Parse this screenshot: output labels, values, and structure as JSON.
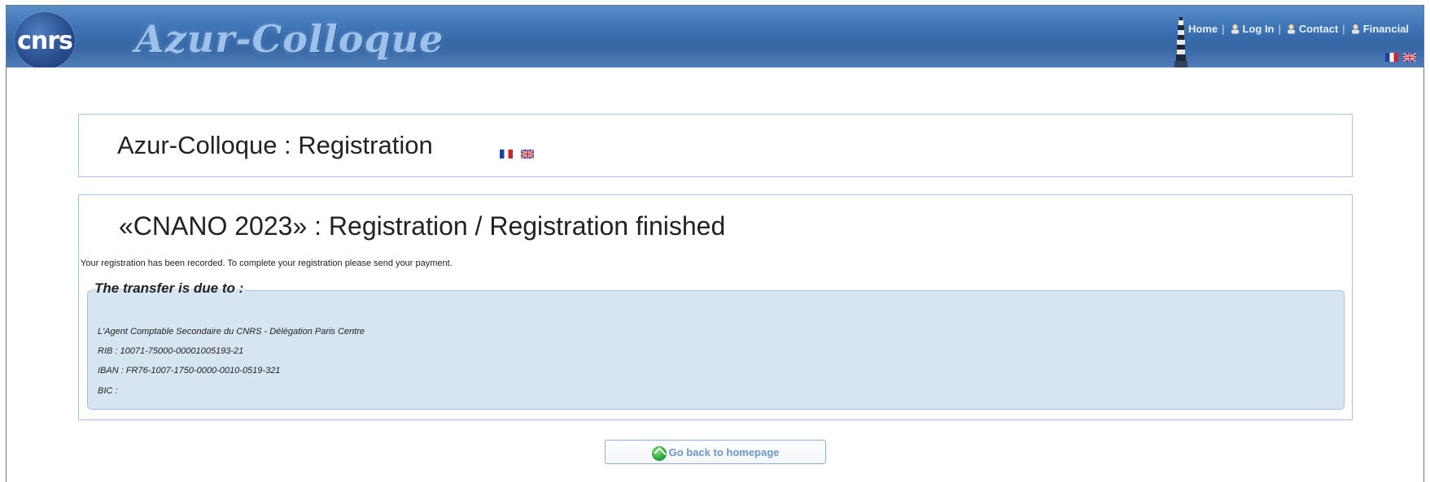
{
  "banner": {
    "logo_text": "cnrs",
    "brand": "Azur-Colloque"
  },
  "topnav": {
    "items": [
      {
        "label": "Home"
      },
      {
        "label": "Log In"
      },
      {
        "label": "Contact"
      },
      {
        "label": "Financial"
      }
    ],
    "separator": "|"
  },
  "header_panel": {
    "title": "Azur-Colloque : Registration"
  },
  "main": {
    "title": "«CNANO 2023» : Registration / Registration finished",
    "notice": "Your registration has been recorded. To complete your registration please send your payment.",
    "transfer": {
      "legend": "The transfer is due to :",
      "lines": [
        "L'Agent Comptable Secondaire du CNRS - Délégation Paris Centre",
        "RIB : 10071-75000-00001005193-21",
        "IBAN : FR76-1007-1750-0000-0010-0519-321",
        "BIC :"
      ]
    }
  },
  "footer": {
    "home_button": "Go back to homepage"
  },
  "colors": {
    "banner": "#3f74b5",
    "panel_border": "#a9c3de",
    "transfer_bg": "#d7e5f3",
    "button_text": "#6c98c8"
  },
  "icons": {
    "flag_fr": "france-flag-icon",
    "flag_uk": "uk-flag-icon",
    "user": "user-icon",
    "home": "home-icon"
  }
}
